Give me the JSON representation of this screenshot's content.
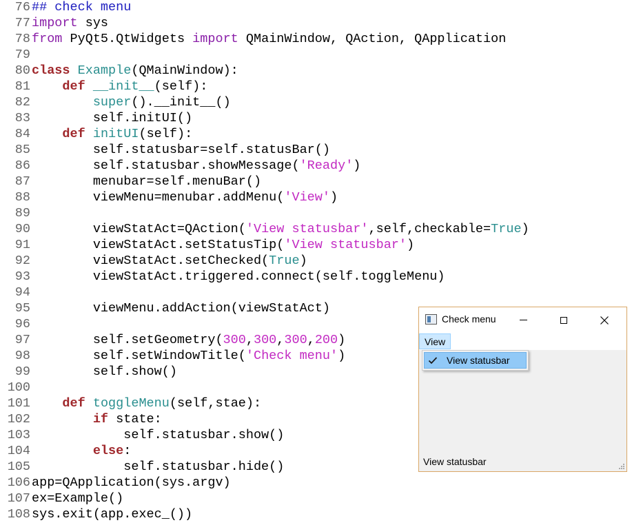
{
  "editor": {
    "lines": [
      {
        "num": "76",
        "tokens": [
          {
            "t": "## check menu",
            "c": "cm"
          }
        ]
      },
      {
        "num": "77",
        "tokens": [
          {
            "t": "import",
            "c": "imp"
          },
          {
            "t": " sys"
          }
        ]
      },
      {
        "num": "78",
        "tokens": [
          {
            "t": "from",
            "c": "imp"
          },
          {
            "t": " PyQt5.QtWidgets "
          },
          {
            "t": "import",
            "c": "imp"
          },
          {
            "t": " QMainWindow, QAction, QApplication"
          }
        ]
      },
      {
        "num": "79",
        "tokens": []
      },
      {
        "num": "80",
        "tokens": [
          {
            "t": "class",
            "c": "kw"
          },
          {
            "t": " "
          },
          {
            "t": "Example",
            "c": "name"
          },
          {
            "t": "(QMainWindow):"
          }
        ]
      },
      {
        "num": "81",
        "tokens": [
          {
            "t": "    "
          },
          {
            "t": "def",
            "c": "kw"
          },
          {
            "t": " "
          },
          {
            "t": "__init__",
            "c": "name"
          },
          {
            "t": "(self):"
          }
        ]
      },
      {
        "num": "82",
        "tokens": [
          {
            "t": "        "
          },
          {
            "t": "super",
            "c": "name"
          },
          {
            "t": "().__init__()"
          }
        ]
      },
      {
        "num": "83",
        "tokens": [
          {
            "t": "        self.initUI()"
          }
        ]
      },
      {
        "num": "84",
        "tokens": [
          {
            "t": "    "
          },
          {
            "t": "def",
            "c": "kw"
          },
          {
            "t": " "
          },
          {
            "t": "initUI",
            "c": "name"
          },
          {
            "t": "(self):"
          }
        ]
      },
      {
        "num": "85",
        "tokens": [
          {
            "t": "        self.statusbar=self.statusBar()"
          }
        ]
      },
      {
        "num": "86",
        "tokens": [
          {
            "t": "        self.statusbar.showMessage("
          },
          {
            "t": "'Ready'",
            "c": "str"
          },
          {
            "t": ")"
          }
        ]
      },
      {
        "num": "87",
        "tokens": [
          {
            "t": "        menubar=self.menuBar()"
          }
        ]
      },
      {
        "num": "88",
        "tokens": [
          {
            "t": "        viewMenu=menubar.addMenu("
          },
          {
            "t": "'View'",
            "c": "str"
          },
          {
            "t": ")"
          }
        ]
      },
      {
        "num": "89",
        "tokens": []
      },
      {
        "num": "90",
        "tokens": [
          {
            "t": "        viewStatAct=QAction("
          },
          {
            "t": "'View statusbar'",
            "c": "str"
          },
          {
            "t": ",self,checkable="
          },
          {
            "t": "True",
            "c": "name"
          },
          {
            "t": ")"
          }
        ]
      },
      {
        "num": "91",
        "tokens": [
          {
            "t": "        viewStatAct.setStatusTip("
          },
          {
            "t": "'View statusbar'",
            "c": "str"
          },
          {
            "t": ")"
          }
        ]
      },
      {
        "num": "92",
        "tokens": [
          {
            "t": "        viewStatAct.setChecked("
          },
          {
            "t": "True",
            "c": "name"
          },
          {
            "t": ")"
          }
        ]
      },
      {
        "num": "93",
        "tokens": [
          {
            "t": "        viewStatAct.triggered.connect(self.toggleMenu)"
          }
        ]
      },
      {
        "num": "94",
        "tokens": []
      },
      {
        "num": "95",
        "tokens": [
          {
            "t": "        viewMenu.addAction(viewStatAct)"
          }
        ]
      },
      {
        "num": "96",
        "tokens": []
      },
      {
        "num": "97",
        "tokens": [
          {
            "t": "        self.setGeometry("
          },
          {
            "t": "300",
            "c": "num"
          },
          {
            "t": ","
          },
          {
            "t": "300",
            "c": "num"
          },
          {
            "t": ","
          },
          {
            "t": "300",
            "c": "num"
          },
          {
            "t": ","
          },
          {
            "t": "200",
            "c": "num"
          },
          {
            "t": ")"
          }
        ]
      },
      {
        "num": "98",
        "tokens": [
          {
            "t": "        self.setWindowTitle("
          },
          {
            "t": "'Check menu'",
            "c": "str"
          },
          {
            "t": ")"
          }
        ]
      },
      {
        "num": "99",
        "tokens": [
          {
            "t": "        self.show()"
          }
        ]
      },
      {
        "num": "100",
        "tokens": []
      },
      {
        "num": "101",
        "tokens": [
          {
            "t": "    "
          },
          {
            "t": "def",
            "c": "kw"
          },
          {
            "t": " "
          },
          {
            "t": "toggleMenu",
            "c": "name"
          },
          {
            "t": "(self,stae):"
          }
        ]
      },
      {
        "num": "102",
        "tokens": [
          {
            "t": "        "
          },
          {
            "t": "if",
            "c": "kw"
          },
          {
            "t": " state:"
          }
        ]
      },
      {
        "num": "103",
        "tokens": [
          {
            "t": "            self.statusbar.show()"
          }
        ]
      },
      {
        "num": "104",
        "tokens": [
          {
            "t": "        "
          },
          {
            "t": "else",
            "c": "kw"
          },
          {
            "t": ":"
          }
        ]
      },
      {
        "num": "105",
        "tokens": [
          {
            "t": "            self.statusbar.hide()"
          }
        ]
      },
      {
        "num": "106",
        "tokens": [
          {
            "t": "app=QApplication(sys.argv)"
          }
        ]
      },
      {
        "num": "107",
        "tokens": [
          {
            "t": "ex=Example()"
          }
        ]
      },
      {
        "num": "108",
        "tokens": [
          {
            "t": "sys.exit(app.exec_())"
          }
        ]
      }
    ]
  },
  "window": {
    "title": "Check menu",
    "menu": "View",
    "menu_item": "View statusbar",
    "menu_item_checked": true,
    "status_text": "View statusbar",
    "icons": {
      "app": "window-icon",
      "check": "check-icon",
      "minimize": "minimize-icon",
      "maximize": "maximize-icon",
      "close": "close-icon",
      "grip": "resize-grip-icon"
    }
  },
  "colors": {
    "keyword": "#a0282c",
    "import": "#8a1fa8",
    "name": "#2a8f8f",
    "string": "#c229c2",
    "comment": "#2020c0",
    "menu_highlight": "#91c9f7",
    "window_border": "#d9a766"
  }
}
